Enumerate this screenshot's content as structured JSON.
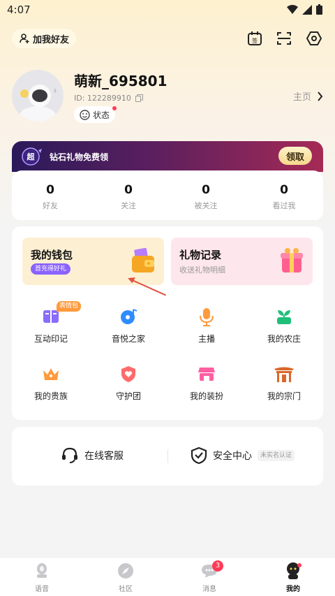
{
  "status_bar": {
    "time": "4:07"
  },
  "topbar": {
    "add_friend_label": "加我好友",
    "icons": [
      "sign-in-calendar-icon",
      "scan-icon",
      "settings-hex-icon"
    ]
  },
  "profile": {
    "nickname": "萌新_695801",
    "id_text": "ID: 122289910",
    "status_label": "状态",
    "home_label": "主页"
  },
  "promo": {
    "badge_text": "超",
    "text": "钻石礼物免费领",
    "button_label": "领取"
  },
  "stats": [
    {
      "value": "0",
      "label": "好友"
    },
    {
      "value": "0",
      "label": "关注"
    },
    {
      "value": "0",
      "label": "被关注"
    },
    {
      "value": "0",
      "label": "看过我"
    }
  ],
  "cards": {
    "wallet": {
      "title": "我的钱包",
      "badge": "首充得好礼"
    },
    "gifts": {
      "title": "礼物记录",
      "subtitle": "收送礼物明细"
    }
  },
  "grid": [
    {
      "label": "互动印记",
      "tag": "表情包",
      "icon": "book-icon"
    },
    {
      "label": "音悦之家",
      "icon": "music-disc-icon"
    },
    {
      "label": "主播",
      "icon": "microphone-icon"
    },
    {
      "label": "我的农庄",
      "icon": "sprout-icon"
    },
    {
      "label": "我的贵族",
      "icon": "crown-icon"
    },
    {
      "label": "守护团",
      "icon": "heart-shield-icon"
    },
    {
      "label": "我的装扮",
      "icon": "store-icon"
    },
    {
      "label": "我的宗门",
      "icon": "gate-icon"
    }
  ],
  "support": {
    "service_label": "在线客服",
    "security_label": "安全中心",
    "security_tag": "未实名认证"
  },
  "tabbar": {
    "tabs": [
      {
        "label": "语音"
      },
      {
        "label": "社区"
      },
      {
        "label": "消息",
        "badge": "3"
      },
      {
        "label": "我的"
      }
    ]
  },
  "colors": {
    "accent_red": "#ff3b57",
    "promo_start": "#2a1a5a",
    "promo_end": "#a52a56",
    "wallet_bg": "#fdf0d2",
    "gift_bg": "#fde6ec"
  }
}
